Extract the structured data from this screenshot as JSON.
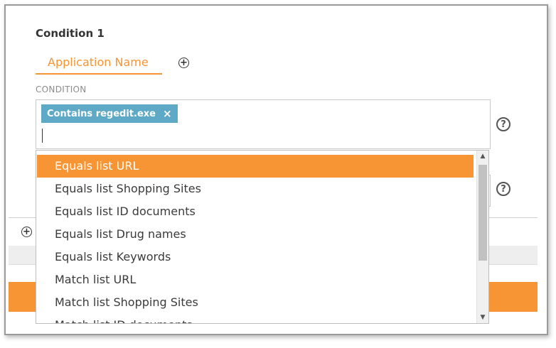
{
  "condition": {
    "title": "Condition 1",
    "tab_label": "Application Name",
    "add_icon": "plus-circle",
    "section_label": "CONDITION",
    "chip": {
      "label": "Contains regedit.exe",
      "remove": "×"
    },
    "help_icon": "?"
  },
  "footer": {
    "add_icon": "plus-circle"
  },
  "dropdown": {
    "options": [
      "Equals list URL",
      "Equals list Shopping Sites",
      "Equals list ID documents",
      "Equals list Drug names",
      "Equals list Keywords",
      "Match list URL",
      "Match list Shopping Sites",
      "Match list ID documents"
    ],
    "selected_index": 0
  },
  "colors": {
    "accent": "#f79433",
    "chip": "#5ea9c6"
  }
}
